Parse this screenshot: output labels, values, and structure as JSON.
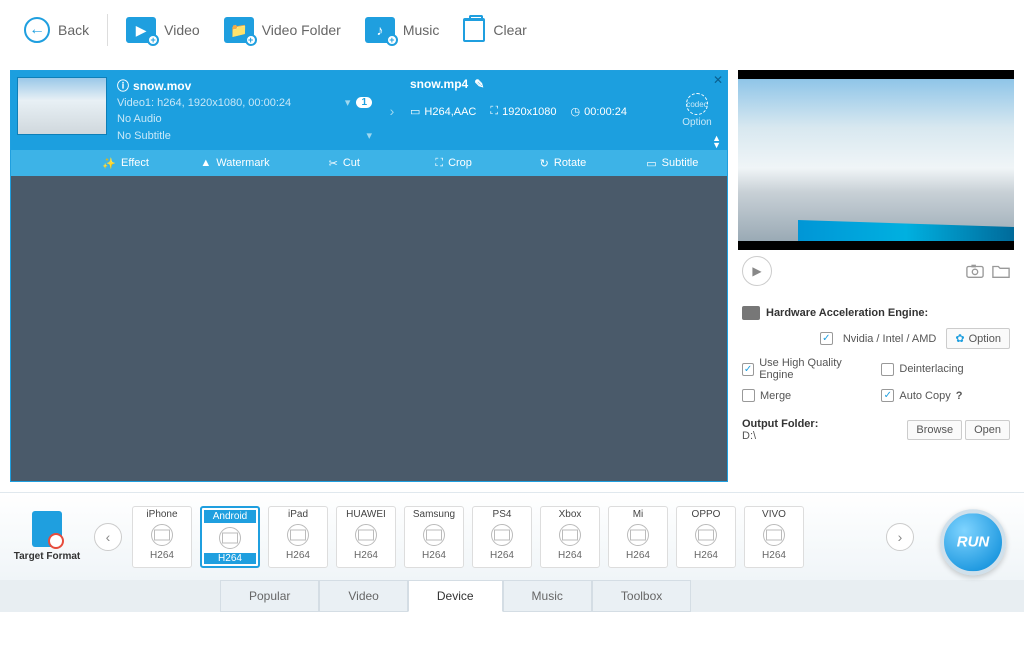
{
  "toolbar": {
    "back": "Back",
    "video": "Video",
    "video_folder": "Video Folder",
    "music": "Music",
    "clear": "Clear"
  },
  "file": {
    "input_name": "snow.mov",
    "video_track": "Video1: h264, 1920x1080, 00:00:24",
    "track_badge": "1",
    "audio_status": "No Audio",
    "subtitle_status": "No Subtitle",
    "output_name": "snow.mp4",
    "codec": "H264,AAC",
    "resolution": "1920x1080",
    "duration": "00:00:24",
    "option_label": "Option"
  },
  "edit": {
    "effect": "Effect",
    "watermark": "Watermark",
    "cut": "Cut",
    "crop": "Crop",
    "rotate": "Rotate",
    "subtitle": "Subtitle"
  },
  "settings": {
    "hw_title": "Hardware Acceleration Engine:",
    "nvidia": "Nvidia / Intel / AMD",
    "option_btn": "Option",
    "hq": "Use High Quality Engine",
    "deinterlace": "Deinterlacing",
    "merge": "Merge",
    "autocopy": "Auto Copy",
    "output_folder_label": "Output Folder:",
    "output_folder_path": "D:\\",
    "browse": "Browse",
    "open": "Open"
  },
  "target_format_label": "Target Format",
  "formats": [
    {
      "name": "iPhone",
      "codec": "H264"
    },
    {
      "name": "Android",
      "codec": "H264"
    },
    {
      "name": "iPad",
      "codec": "H264"
    },
    {
      "name": "HUAWEI",
      "codec": "H264"
    },
    {
      "name": "Samsung",
      "codec": "H264"
    },
    {
      "name": "PS4",
      "codec": "H264"
    },
    {
      "name": "Xbox",
      "codec": "H264"
    },
    {
      "name": "Mi",
      "codec": "H264"
    },
    {
      "name": "OPPO",
      "codec": "H264"
    },
    {
      "name": "VIVO",
      "codec": "H264"
    }
  ],
  "tabs": {
    "popular": "Popular",
    "video": "Video",
    "device": "Device",
    "music": "Music",
    "toolbox": "Toolbox"
  },
  "run": "RUN"
}
